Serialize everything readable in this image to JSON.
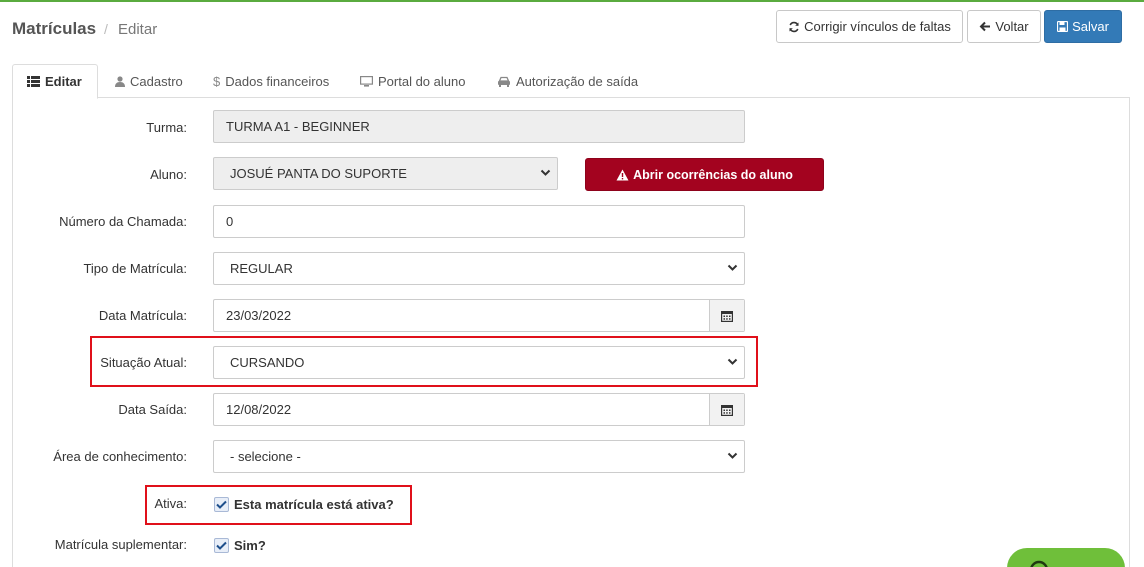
{
  "breadcrumb": {
    "title": "Matrículas",
    "separator": "/",
    "current": "Editar"
  },
  "toolbar": {
    "fix_label": "Corrigir vínculos de faltas",
    "back_label": "Voltar",
    "save_label": "Salvar"
  },
  "tabs": [
    {
      "label": "Editar",
      "icon": "list-icon",
      "active": true
    },
    {
      "label": "Cadastro",
      "icon": "user-icon"
    },
    {
      "label": "Dados financeiros",
      "icon": "dollar-icon"
    },
    {
      "label": "Portal do aluno",
      "icon": "monitor-icon"
    },
    {
      "label": "Autorização de saída",
      "icon": "car-icon"
    }
  ],
  "form": {
    "turma": {
      "label": "Turma:",
      "value": "TURMA A1 - BEGINNER"
    },
    "aluno": {
      "label": "Aluno:",
      "value": "JOSUÉ PANTA DO SUPORTE"
    },
    "ocorrencias_button": "Abrir ocorrências do aluno",
    "numero_chamada": {
      "label": "Número da Chamada:",
      "value": "0"
    },
    "tipo_matricula": {
      "label": "Tipo de Matrícula:",
      "value": "REGULAR"
    },
    "data_matricula": {
      "label": "Data Matrícula:",
      "value": "23/03/2022"
    },
    "situacao_atual": {
      "label": "Situação Atual:",
      "value": "CURSANDO"
    },
    "data_saida": {
      "label": "Data Saída:",
      "value": "12/08/2022"
    },
    "area_conhecimento": {
      "label": "Área de conhecimento:",
      "value": "- selecione -"
    },
    "ativa": {
      "label": "Ativa:",
      "checkbox_label": "Esta matrícula está ativa?",
      "checked": true
    },
    "suplementar": {
      "label": "Matrícula suplementar:",
      "checkbox_label": "Sim?",
      "checked": true
    }
  },
  "colors": {
    "primary": "#337ab7",
    "danger": "#a3031f",
    "highlight": "#e0101a",
    "accent_green": "#5aab3f"
  }
}
